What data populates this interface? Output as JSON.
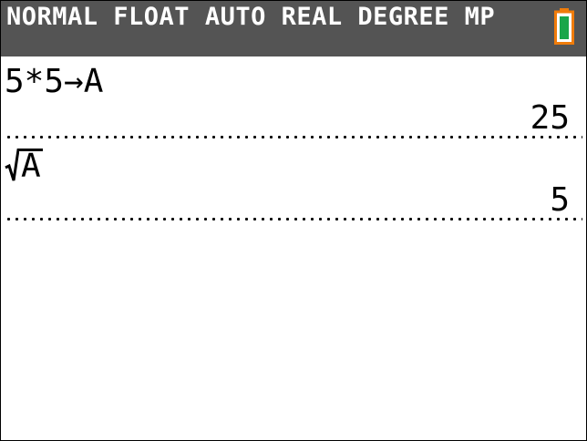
{
  "status_bar": {
    "text": "NORMAL FLOAT AUTO REAL DEGREE MP",
    "background": "#545454",
    "text_color": "#ffffff",
    "battery": {
      "icon": "battery-icon",
      "outline_color": "#f07c0a",
      "fill_color": "#1aa64a",
      "level": 1.0
    }
  },
  "history": [
    {
      "expression": "5*5→A",
      "result": "25"
    },
    {
      "expression_symbol": "sqrt-icon",
      "expression_radicand": "A",
      "result": "5"
    }
  ]
}
